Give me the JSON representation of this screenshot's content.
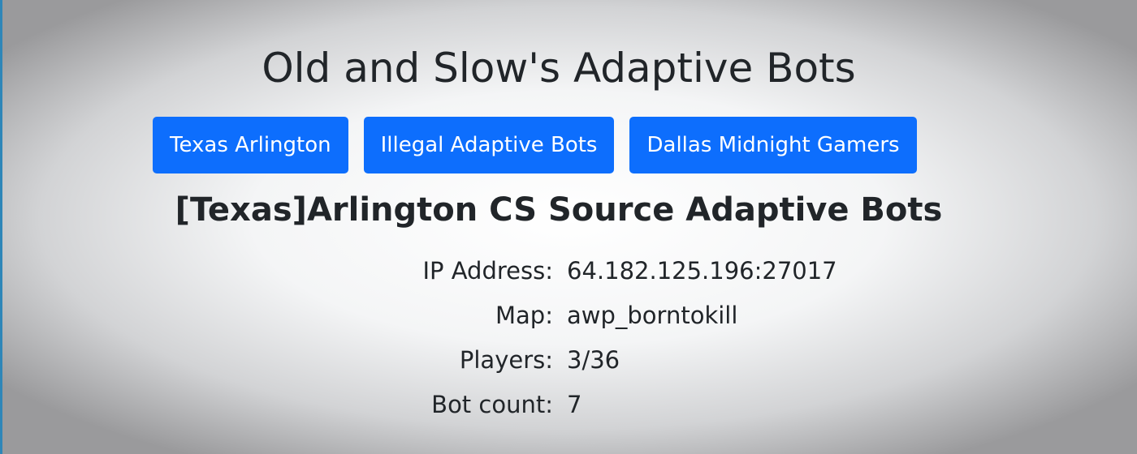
{
  "header": {
    "title": "Old and Slow's Adaptive Bots"
  },
  "servers": [
    {
      "label": "Texas Arlington"
    },
    {
      "label": "Illegal Adaptive Bots"
    },
    {
      "label": "Dallas Midnight Gamers"
    }
  ],
  "server": {
    "name": "[Texas]Arlington CS Source Adaptive Bots",
    "fields": [
      {
        "label": "IP Address:",
        "value": "64.182.125.196:27017"
      },
      {
        "label": "Map:",
        "value": "awp_borntokill"
      },
      {
        "label": "Players:",
        "value": "3/36"
      },
      {
        "label": "Bot count:",
        "value": "7"
      }
    ]
  },
  "colors": {
    "accent": "#0d6efd",
    "edge": "#2e86b8"
  }
}
